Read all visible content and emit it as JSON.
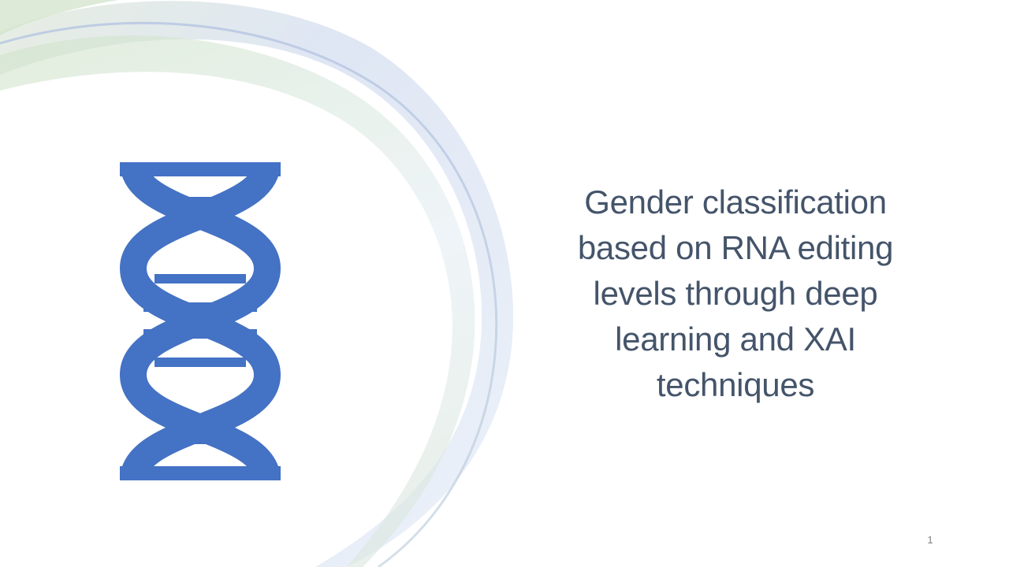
{
  "slide": {
    "title": "Gender classification based on RNA editing levels through deep learning and XAI techniques",
    "page_number": "1",
    "icon": "dna-icon",
    "colors": {
      "title_text": "#44546a",
      "icon_fill": "#4472c4",
      "background": "#ffffff",
      "swoosh_blue": "#c9d6ee",
      "swoosh_green": "#d5e5d0"
    }
  }
}
